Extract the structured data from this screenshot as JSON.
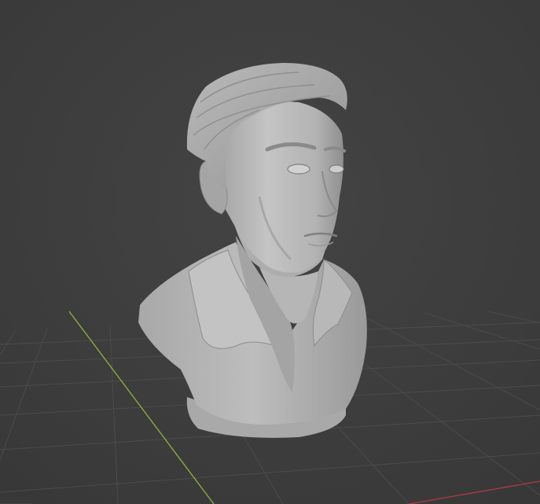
{
  "viewport": {
    "background": "#3d3d3d",
    "grid_line_color": "#4a4a4a",
    "y_axis_color": "#8cb33a",
    "x_axis_color": "#b03a45",
    "model_color": "#b5b5b5",
    "object": "sculpted-bust"
  }
}
